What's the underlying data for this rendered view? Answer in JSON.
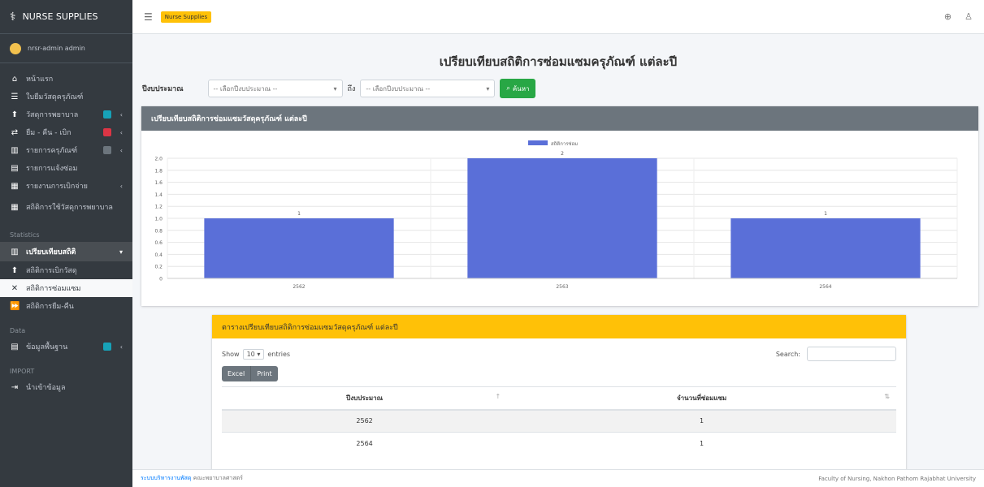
{
  "sidebar": {
    "brand": "NURSE SUPPLIES",
    "user": "nrsr-admin admin",
    "items": [
      {
        "label": "หน้าแรก"
      },
      {
        "label": "ใบยืมวัสดุครุภัณฑ์"
      },
      {
        "label": "วัสดุการพยาบาล"
      },
      {
        "label": "ยืม - คืน - เบิก"
      },
      {
        "label": "รายการครุภัณฑ์"
      },
      {
        "label": "รายการแจ้งซ่อม"
      },
      {
        "label": "รายงานการเบิกจ่าย"
      },
      {
        "label": "สถิติการใช้วัสดุการพยาบาล"
      }
    ],
    "statistics_header": "Statistics",
    "stats_open": "เปรียบเทียบสถิติ",
    "stats_items": [
      {
        "label": "สถิติการเบิกวัสดุ"
      },
      {
        "label": "สถิติการซ่อมแซม"
      },
      {
        "label": "สถิติการยืม-คืน"
      }
    ],
    "data_header": "Data",
    "data_items": [
      {
        "label": "ข้อมูลพื้นฐาน"
      }
    ],
    "import_header": "IMPORT",
    "import_items": [
      {
        "label": "นำเข้าข้อมูล"
      }
    ]
  },
  "topbar": {
    "chip": "Nurse Supplies"
  },
  "page": {
    "title": "เปรียบเทียบสถิติการซ่อมแซมครุภัณฑ์ แต่ละปี"
  },
  "filter": {
    "label": "ปีงบประมาณ",
    "from_placeholder": "-- เลือกปีงบประมาณ --",
    "to_label": "ถึง",
    "to_placeholder": "-- เลือกปีงบประมาณ --",
    "search_button": "ค้นหา"
  },
  "chart_card": {
    "header": "เปรียบเทียบสถิติการซ่อมแซมวัสดุครุภัณฑ์ แต่ละปี"
  },
  "chart_data": {
    "type": "bar",
    "categories": [
      "2562",
      "2563",
      "2564"
    ],
    "series": [
      {
        "name": "สถิติการซ่อม",
        "values": [
          1,
          2,
          1
        ]
      }
    ],
    "data_labels": [
      "1",
      "2",
      "1"
    ],
    "ylim": [
      0,
      2
    ],
    "yticks": [
      "0",
      "0.2",
      "0.4",
      "0.6",
      "0.8",
      "1.0",
      "1.2",
      "1.4",
      "1.6",
      "1.8",
      "2.0"
    ],
    "grid": true,
    "legend": "top",
    "color": "#5a6fd8"
  },
  "table_card": {
    "header": "ตารางเปรียบเทียบสถิติการซ่อมแซมวัสดุครุภัณฑ์ แต่ละปี",
    "show_label": "Show",
    "entries_value": "10",
    "entries_label": "entries",
    "search_label": "Search:",
    "excel_button": "Excel",
    "print_button": "Print",
    "columns": [
      "ปีงบประมาณ",
      "จำนวนที่ซ่อมแซม"
    ],
    "rows": [
      [
        "2562",
        "1"
      ],
      [
        "2564",
        "1"
      ]
    ]
  },
  "footer": {
    "left_link": "ระบบบริหารงานพัสดุ",
    "left_text": "คณะพยาบาลศาสตร์",
    "right_text": "Faculty of Nursing, Nakhon Pathom Rajabhat University"
  }
}
